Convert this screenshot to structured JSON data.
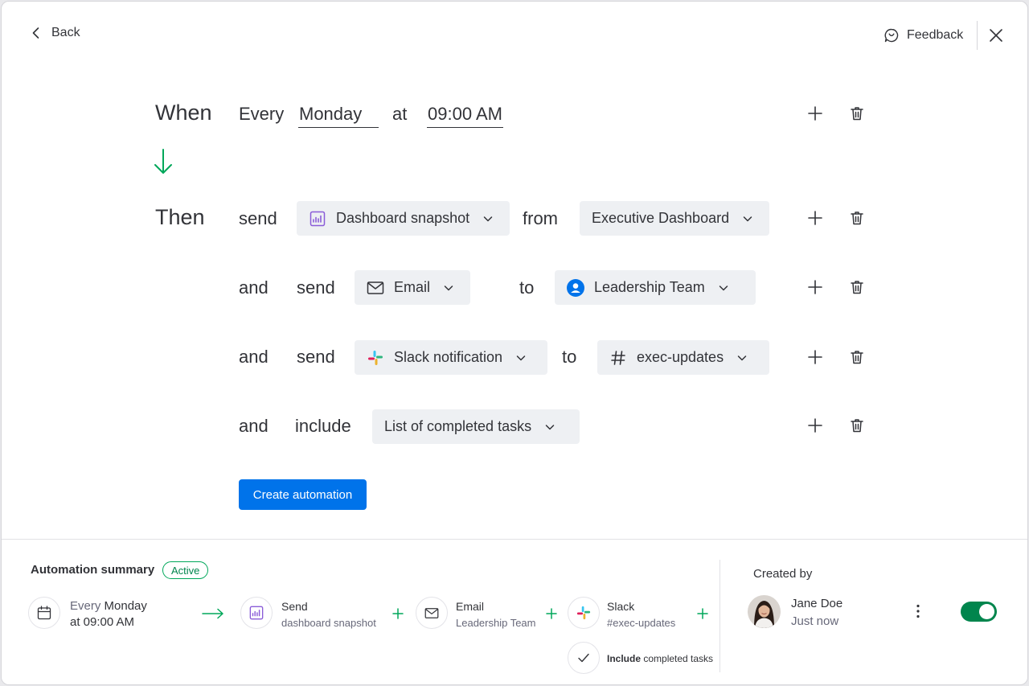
{
  "header": {
    "back_label": "Back",
    "feedback_label": "Feedback"
  },
  "trigger": {
    "keyword": "When",
    "every_word": "Every",
    "day_value": "Monday",
    "at_word": "at",
    "time_value": "09:00 AM"
  },
  "actions": {
    "then_keyword": "Then",
    "row1": {
      "verb": "send",
      "item_label": "Dashboard snapshot",
      "from_word": "from",
      "source_label": "Executive Dashboard"
    },
    "row2": {
      "connector": "and",
      "verb": "send",
      "channel_label": "Email",
      "to_word": "to",
      "recipient_label": "Leadership Team"
    },
    "row3": {
      "connector": "and",
      "verb": "send",
      "channel_label": "Slack notification",
      "to_word": "to",
      "recipient_label": "exec-updates"
    },
    "row4": {
      "connector": "and",
      "verb": "include",
      "item_label": "List of completed tasks"
    }
  },
  "create_button_label": "Create automation",
  "summary": {
    "title": "Automation summary",
    "status": "Active",
    "trigger_line1_prefix": "Every ",
    "trigger_line1_day": "Monday",
    "trigger_line2": "at 09:00 AM",
    "step1_title": "Send",
    "step1_sub": "dashboard snapshot",
    "step2_title": "Email",
    "step2_sub": "Leadership Team",
    "step3_title": "Slack",
    "step3_sub": "#exec-updates",
    "step4_bold": "Include",
    "step4_rest": " completed tasks"
  },
  "creator": {
    "label": "Created by",
    "name": "Jane Doe",
    "time": "Just now",
    "toggle_on": true
  },
  "colors": {
    "primary": "#0073ea",
    "success": "#00854d",
    "flow_arrow": "#00a75a",
    "chip_bg": "#eef0f3",
    "dashboard_icon": "#8a5cd8"
  }
}
